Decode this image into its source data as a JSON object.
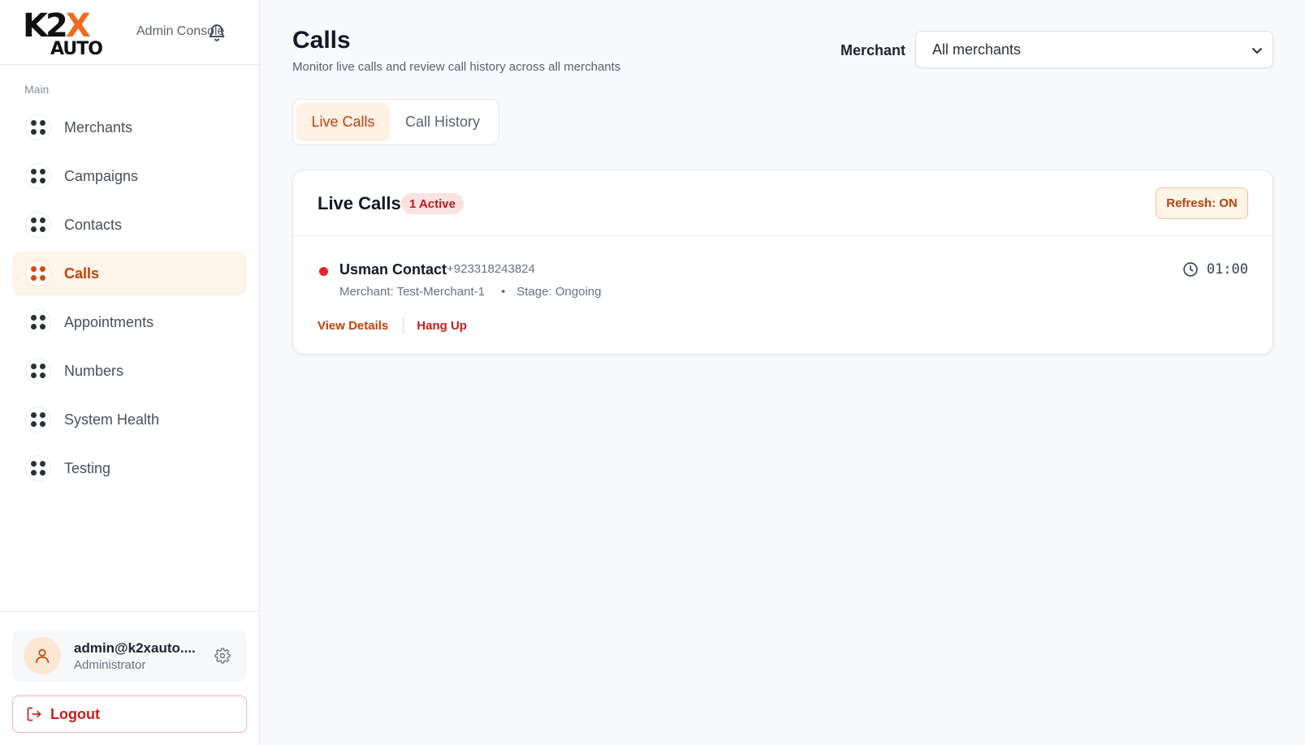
{
  "brand": {
    "logo_text_top": "K2",
    "logo_text_x": "X",
    "logo_text_bottom": "AUTO",
    "subtitle": "Admin Console",
    "accent_color": "#f26b1d"
  },
  "sidebar": {
    "section_label": "Main",
    "items": [
      {
        "label": "Merchants",
        "icon": "grid-dots-icon",
        "active": false
      },
      {
        "label": "Campaigns",
        "icon": "grid-dots-icon",
        "active": false
      },
      {
        "label": "Contacts",
        "icon": "grid-dots-icon",
        "active": false
      },
      {
        "label": "Calls",
        "icon": "grid-dots-icon",
        "active": true
      },
      {
        "label": "Appointments",
        "icon": "grid-dots-icon",
        "active": false
      },
      {
        "label": "Numbers",
        "icon": "grid-dots-icon",
        "active": false
      },
      {
        "label": "System Health",
        "icon": "grid-dots-icon",
        "active": false
      },
      {
        "label": "Testing",
        "icon": "grid-dots-icon",
        "active": false
      }
    ],
    "user": {
      "email": "admin@k2xauto....",
      "role": "Administrator"
    },
    "logout_label": "Logout"
  },
  "header": {
    "title": "Calls",
    "subtitle": "Monitor live calls and review call history across all merchants",
    "merchant_label": "Merchant",
    "merchant_selected": "All merchants"
  },
  "tabs": [
    {
      "label": "Live Calls",
      "active": true
    },
    {
      "label": "Call History",
      "active": false
    }
  ],
  "live_calls": {
    "title": "Live Calls",
    "active_badge": "1 Active",
    "refresh_label": "Refresh: ON",
    "calls": [
      {
        "contact_name": "Usman Contact",
        "phone": "+923318243824",
        "merchant": "Merchant: Test-Merchant-1",
        "separator": "•",
        "stage": "Stage: Ongoing",
        "duration": "01:00",
        "status_color": "#e5262b",
        "view_details_label": "View Details",
        "hang_up_label": "Hang Up"
      }
    ]
  }
}
